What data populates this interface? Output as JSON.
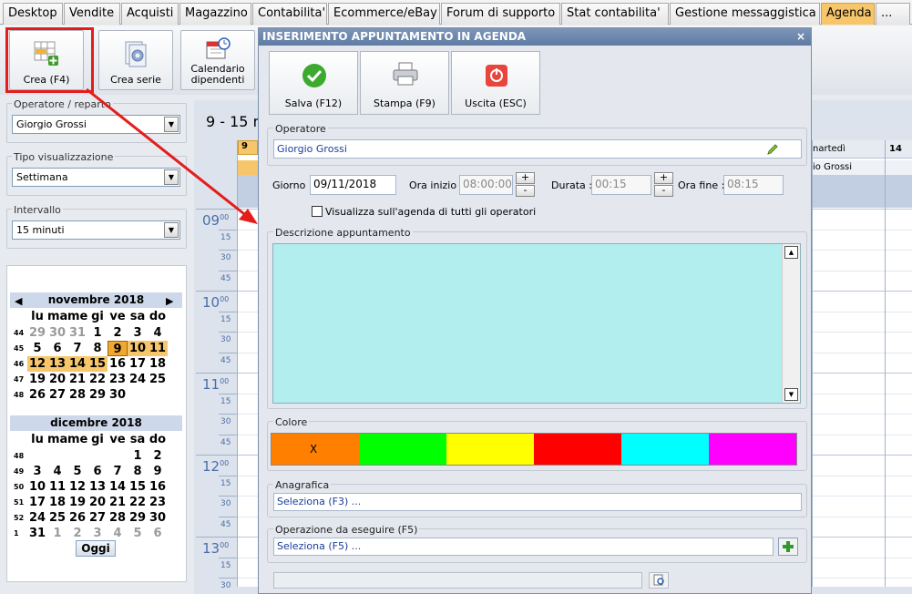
{
  "tabs": [
    {
      "label": "Desktop"
    },
    {
      "label": "Vendite"
    },
    {
      "label": "Acquisti"
    },
    {
      "label": "Magazzino"
    },
    {
      "label": "Contabilita'"
    },
    {
      "label": "Ecommerce/eBay"
    },
    {
      "label": "Forum di supporto"
    },
    {
      "label": "Stat contabilita'"
    },
    {
      "label": "Gestione messaggistica"
    },
    {
      "label": "Agenda"
    },
    {
      "label": "..."
    }
  ],
  "toolbar": {
    "crea": "Crea (F4)",
    "crea_serie": "Crea serie",
    "calendario": "Calendario dipendenti"
  },
  "left": {
    "operatore_label": "Operatore / reparto",
    "operatore_value": "Giorgio Grossi",
    "tipo_label": "Tipo visualizzazione",
    "tipo_value": "Settimana",
    "intervallo_label": "Intervallo",
    "intervallo_value": "15 minuti"
  },
  "calendar": {
    "weekdays": [
      "lu",
      "ma",
      "me",
      "gi",
      "ve",
      "sa",
      "do"
    ],
    "months": [
      {
        "title": "novembre 2018",
        "weeks": [
          {
            "wk": "44",
            "days": [
              "29",
              "30",
              "31",
              "1",
              "2",
              "3",
              "4"
            ]
          },
          {
            "wk": "45",
            "days": [
              "5",
              "6",
              "7",
              "8",
              "9",
              "10",
              "11"
            ]
          },
          {
            "wk": "46",
            "days": [
              "12",
              "13",
              "14",
              "15",
              "16",
              "17",
              "18"
            ]
          },
          {
            "wk": "47",
            "days": [
              "19",
              "20",
              "21",
              "22",
              "23",
              "24",
              "25"
            ]
          },
          {
            "wk": "48",
            "days": [
              "26",
              "27",
              "28",
              "29",
              "30",
              "",
              ""
            ]
          }
        ]
      },
      {
        "title": "dicembre 2018",
        "weeks": [
          {
            "wk": "48",
            "days": [
              "",
              "",
              "",
              "",
              "",
              "1",
              "2"
            ]
          },
          {
            "wk": "49",
            "days": [
              "3",
              "4",
              "5",
              "6",
              "7",
              "8",
              "9"
            ]
          },
          {
            "wk": "50",
            "days": [
              "10",
              "11",
              "12",
              "13",
              "14",
              "15",
              "16"
            ]
          },
          {
            "wk": "51",
            "days": [
              "17",
              "18",
              "19",
              "20",
              "21",
              "22",
              "23"
            ]
          },
          {
            "wk": "52",
            "days": [
              "24",
              "25",
              "26",
              "27",
              "28",
              "29",
              "30"
            ]
          },
          {
            "wk": "1",
            "days": [
              "31",
              "1",
              "2",
              "3",
              "4",
              "5",
              "6"
            ]
          }
        ]
      }
    ],
    "today_button": "Oggi"
  },
  "agenda": {
    "range_title": "9 - 15 n",
    "col_day_num": "9",
    "col_day2_name": "nartedì",
    "col_day3_num": "14",
    "operator_short": "io Grossi",
    "hours": [
      {
        "h": "09",
        "m": "00"
      },
      {
        "h": "10",
        "m": "00"
      },
      {
        "h": "11",
        "m": "00"
      },
      {
        "h": "12",
        "m": "00"
      },
      {
        "h": "13",
        "m": "00"
      }
    ],
    "quarters": [
      "15",
      "30",
      "45"
    ]
  },
  "dialog": {
    "title": "INSERIMENTO APPUNTAMENTO IN AGENDA",
    "close": "×",
    "btn_salva": "Salva (F12)",
    "btn_stampa": "Stampa (F9)",
    "btn_uscita": "Uscita (ESC)",
    "operatore_label": "Operatore",
    "operatore_value": "Giorgio Grossi",
    "giorno_label": "Giorno :",
    "giorno_value": "09/11/2018",
    "ora_inizio_label": "Ora inizio :",
    "ora_inizio_value": "08:00:00",
    "durata_label": "Durata :",
    "durata_value": "00:15",
    "ora_fine_label": "Ora fine :",
    "ora_fine_value": "08:15",
    "plus": "+",
    "minus": "-",
    "visualizza_label": "Visualizza sull'agenda di tutti gli operatori",
    "descrizione_label": "Descrizione appuntamento",
    "colore_label": "Colore",
    "colors": [
      "#ff8000",
      "#00ff00",
      "#ffff00",
      "#ff0000",
      "#00ffff",
      "#ff00ff"
    ],
    "selected_mark": "X",
    "anagrafica_label": "Anagrafica",
    "anagrafica_value": "Seleziona (F3) ...",
    "operazione_label": "Operazione da eseguire (F5)",
    "operazione_value": "Seleziona (F5) ..."
  }
}
